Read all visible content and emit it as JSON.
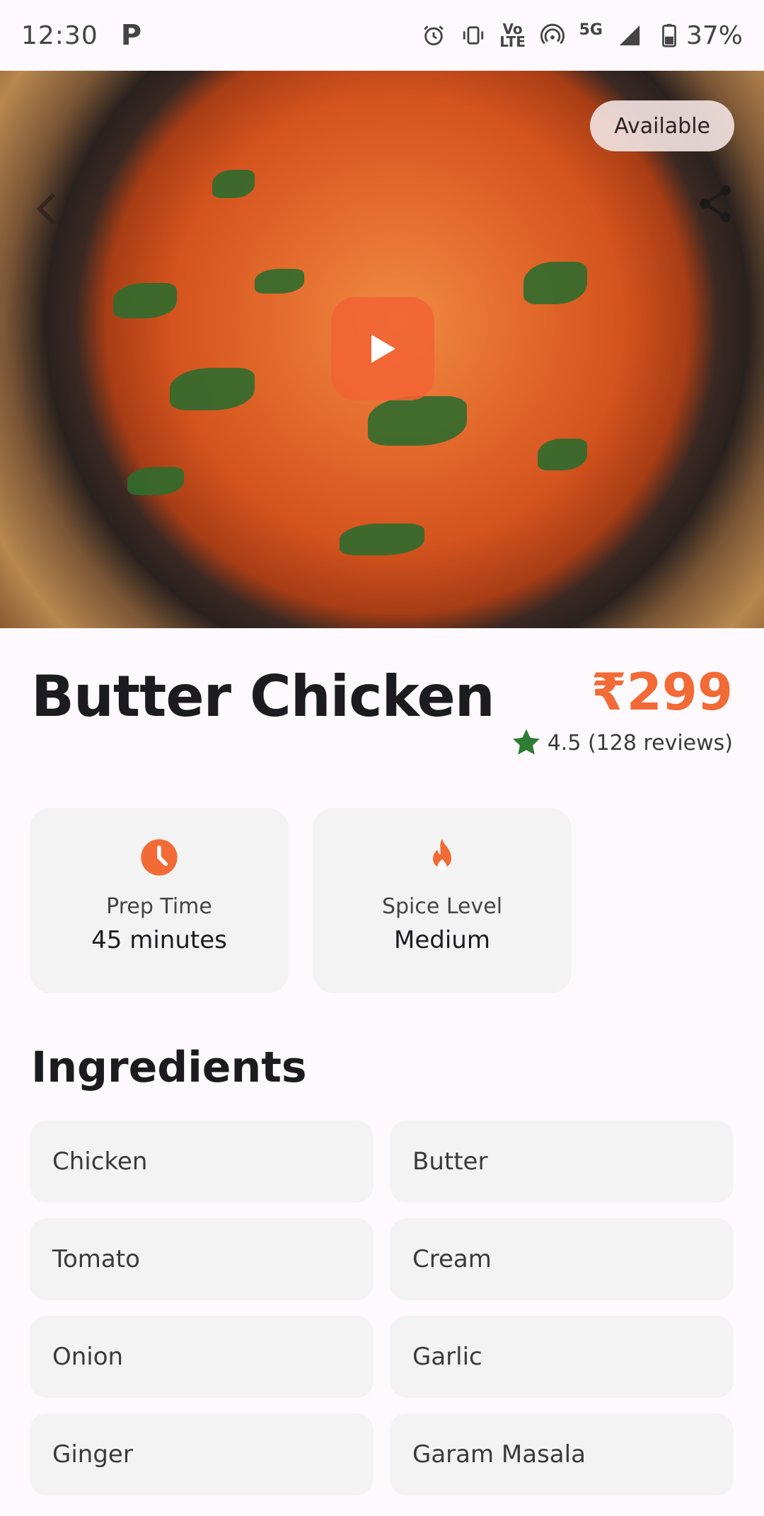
{
  "status_bar": {
    "time": "12:30",
    "app_icon": "P",
    "lte_text": "Vo\nLTE",
    "network": "5G",
    "battery": "37%"
  },
  "hero": {
    "badge": "Available",
    "icons": [
      "back-icon",
      "share-icon",
      "play-icon"
    ]
  },
  "dish": {
    "title": "Butter Chicken",
    "price": "₹299",
    "rating": "4.5 (128 reviews)"
  },
  "info_cards": [
    {
      "label": "Prep Time",
      "value": "45 minutes",
      "icon": "clock-icon"
    },
    {
      "label": "Spice Level",
      "value": "Medium",
      "icon": "fire-icon"
    }
  ],
  "ingredients": {
    "title": "Ingredients",
    "items": [
      "Chicken",
      "Butter",
      "Tomato",
      "Cream",
      "Onion",
      "Garlic",
      "Ginger",
      "Garam Masala"
    ]
  },
  "colors": {
    "accent": "#f26a35",
    "star": "#2e7d32",
    "card_bg": "#f3f3f3"
  }
}
